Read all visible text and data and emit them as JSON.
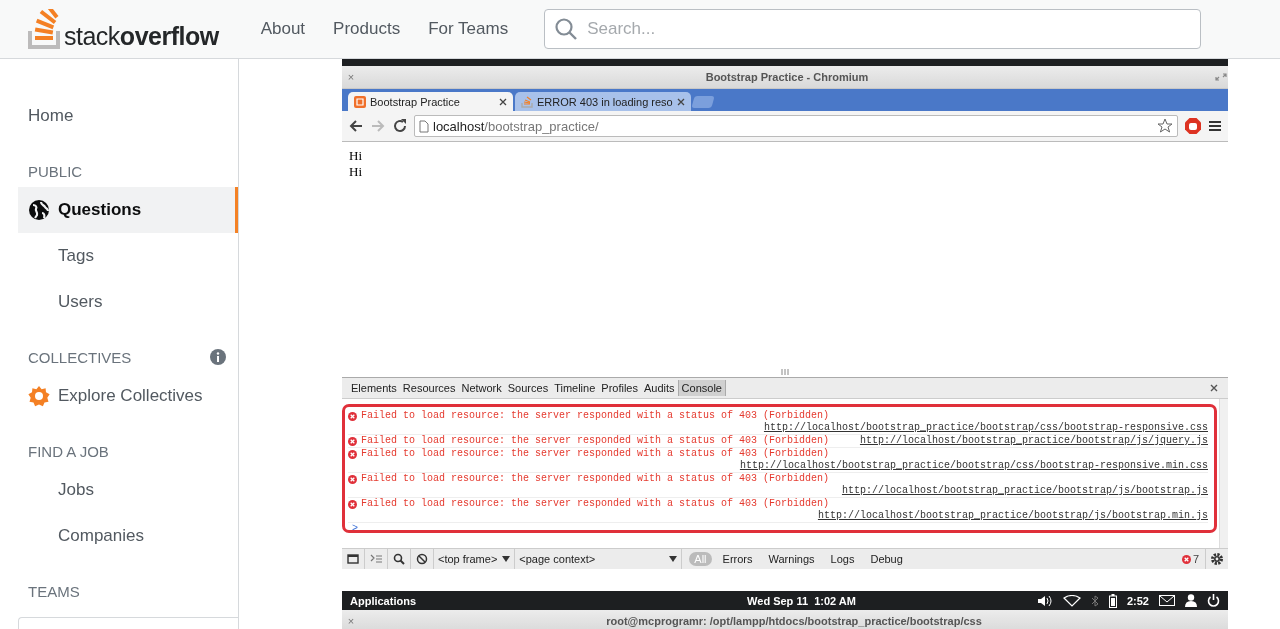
{
  "header": {
    "logo": "stack**overflow**",
    "nav": [
      "About",
      "Products",
      "For Teams"
    ],
    "search": {
      "placeholder": "Search..."
    }
  },
  "sidebar": {
    "items": [
      {
        "kind": "link",
        "label": "Home",
        "selected": false
      },
      {
        "kind": "heading",
        "label": "PUBLIC"
      },
      {
        "kind": "globe-link",
        "label": "Questions",
        "selected": true
      },
      {
        "kind": "sublink",
        "label": "Tags",
        "selected": false
      },
      {
        "kind": "sublink",
        "label": "Users",
        "selected": false
      },
      {
        "kind": "info-heading",
        "label": "COLLECTIVES"
      },
      {
        "kind": "collective-link",
        "label": "Explore Collectives",
        "selected": false
      },
      {
        "kind": "heading",
        "label": "FIND A JOB"
      },
      {
        "kind": "sublink",
        "label": "Jobs",
        "selected": false
      },
      {
        "kind": "sublink",
        "label": "Companies",
        "selected": false
      },
      {
        "kind": "heading",
        "label": "TEAMS"
      }
    ]
  },
  "browser": {
    "close": "×",
    "title": "Bootstrap Practice - Chromium",
    "tabs": [
      {
        "label": "Bootstrap Practice",
        "selected": true
      },
      {
        "label": "ERROR 403 in loading reso",
        "selected": false
      }
    ],
    "address": {
      "host": "localhost",
      "path": "/bootstrap_practice/"
    },
    "page_lines": [
      "Hi",
      "Hi"
    ],
    "devtools": {
      "tabs": [
        {
          "label": "Elements",
          "selected": false
        },
        {
          "label": "Resources",
          "selected": false
        },
        {
          "label": "Network",
          "selected": false
        },
        {
          "label": "Sources",
          "selected": false
        },
        {
          "label": "Timeline",
          "selected": false
        },
        {
          "label": "Profiles",
          "selected": false
        },
        {
          "label": "Audits",
          "selected": false
        },
        {
          "label": "Console",
          "selected": true
        }
      ],
      "messages": [
        {
          "kind": "wrapped",
          "text": "Failed to load resource: the server responded with a status of 403 (Forbidden)",
          "url": "http://localhost/bootstrap_practice/bootstrap/css/bootstrap-responsive.css"
        },
        {
          "kind": "inline",
          "text": "Failed to load resource: the server responded with a status of 403 (Forbidden)",
          "url": "http://localhost/bootstrap_practice/bootstrap/js/jquery.js"
        },
        {
          "kind": "wrapped",
          "text": "Failed to load resource: the server responded with a status of 403 (Forbidden)",
          "url": "http://localhost/bootstrap_practice/bootstrap/css/bootstrap-responsive.min.css"
        },
        {
          "kind": "wrapped",
          "text": "Failed to load resource: the server responded with a status of 403 (Forbidden)",
          "url": "http://localhost/bootstrap_practice/bootstrap/js/bootstrap.js"
        },
        {
          "kind": "wrapped",
          "text": "Failed to load resource: the server responded with a status of 403 (Forbidden)",
          "url": "http://localhost/bootstrap_practice/bootstrap/js/bootstrap.min.js"
        }
      ],
      "prompt": ">",
      "contexts": [
        "<top frame>",
        "<page context>"
      ],
      "filters": [
        {
          "label": "All",
          "selected": true
        },
        {
          "label": "Errors",
          "selected": false
        },
        {
          "label": "Warnings",
          "selected": false
        },
        {
          "label": "Logs",
          "selected": false
        },
        {
          "label": "Debug",
          "selected": false
        }
      ],
      "error_count": "7"
    }
  },
  "os_bar": {
    "menu": "Applications",
    "clock": "Wed Sep 11  1:02 AM",
    "time": "2:52"
  },
  "terminal": {
    "close": "×",
    "title": "root@mcprogramr: /opt/lampp/htdocs/bootstrap_practice/bootstrap/css"
  }
}
